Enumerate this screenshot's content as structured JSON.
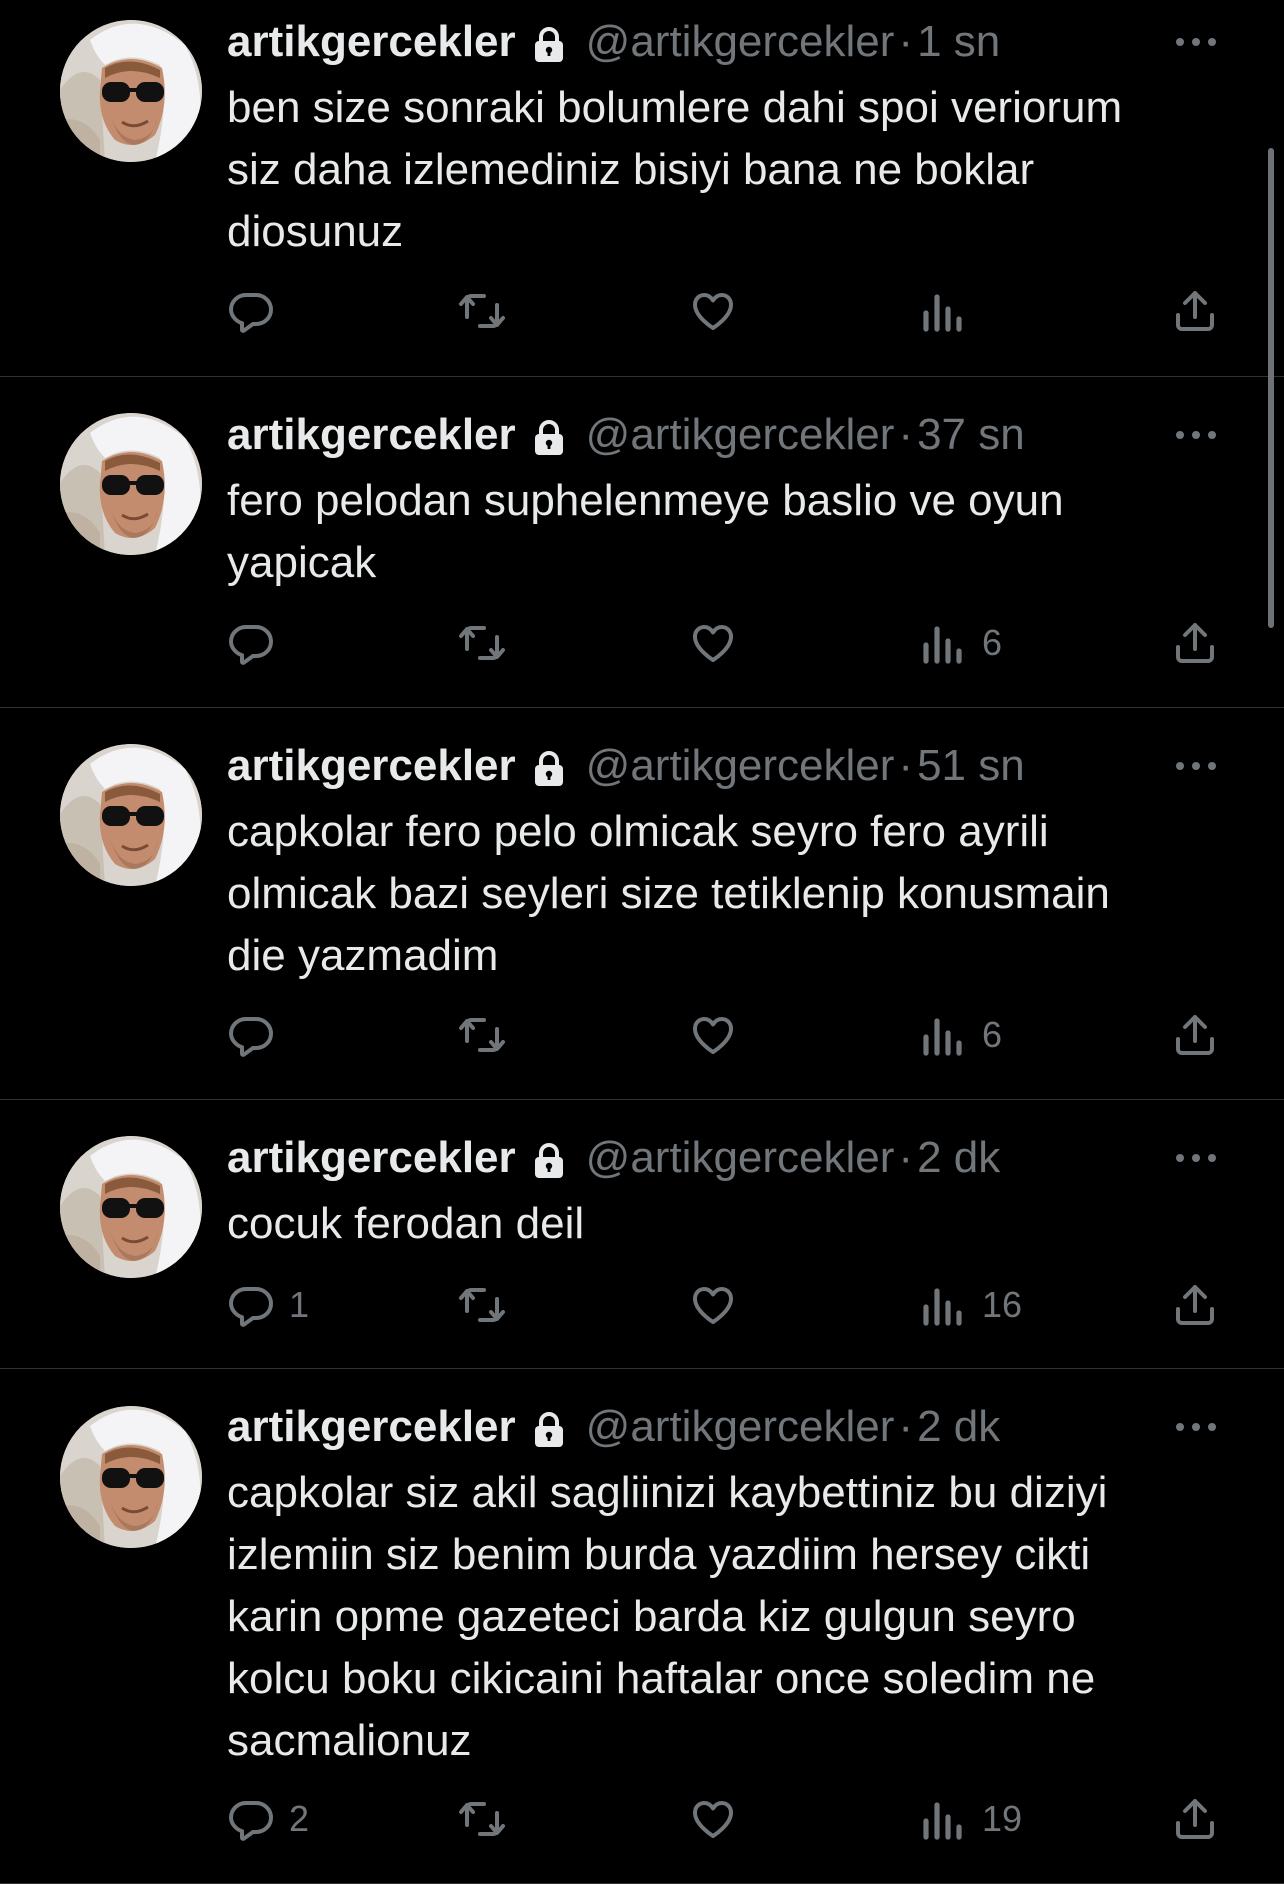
{
  "colors": {
    "background": "#000000",
    "text_primary": "#e7e9ea",
    "text_secondary": "#71767b",
    "divider": "#2f3336"
  },
  "icons": {
    "lock": "lock-icon",
    "more": "more-icon",
    "reply": "reply-icon",
    "retweet": "retweet-icon",
    "like": "heart-icon",
    "views": "views-icon",
    "share": "share-icon"
  },
  "tweets": [
    {
      "name": "artikgercekler",
      "handle": "@artikgercekler",
      "separator": "·",
      "time": "1 sn",
      "text": "ben size sonraki bolumlere dahi spoi veriorum\nsiz daha izlemediniz bisiyi bana ne boklar\ndiosunuz",
      "replies": "",
      "retweets": "",
      "likes": "",
      "views": ""
    },
    {
      "name": "artikgercekler",
      "handle": "@artikgercekler",
      "separator": "·",
      "time": "37 sn",
      "text": "fero pelodan suphelenmeye baslio ve oyun\nyapicak",
      "replies": "",
      "retweets": "",
      "likes": "",
      "views": "6"
    },
    {
      "name": "artikgercekler",
      "handle": "@artikgercekler",
      "separator": "·",
      "time": "51 sn",
      "text": "capkolar fero pelo olmicak seyro fero ayrili\nolmicak bazi seyleri size tetiklenip konusmain\ndie yazmadim",
      "replies": "",
      "retweets": "",
      "likes": "",
      "views": "6"
    },
    {
      "name": "artikgercekler",
      "handle": "@artikgercekler",
      "separator": "·",
      "time": "2 dk",
      "text": "cocuk ferodan deil",
      "replies": "1",
      "retweets": "",
      "likes": "",
      "views": "16"
    },
    {
      "name": "artikgercekler",
      "handle": "@artikgercekler",
      "separator": "·",
      "time": "2 dk",
      "text": "capkolar siz akil sagliinizi kaybettiniz bu diziyi\nizlemiin siz benim burda yazdiim hersey cikti\nkarin opme gazeteci barda kiz gulgun seyro\nkolcu boku cikicaini haftalar once soledim ne\nsacmalionuz",
      "replies": "2",
      "retweets": "",
      "likes": "",
      "views": "19"
    }
  ]
}
